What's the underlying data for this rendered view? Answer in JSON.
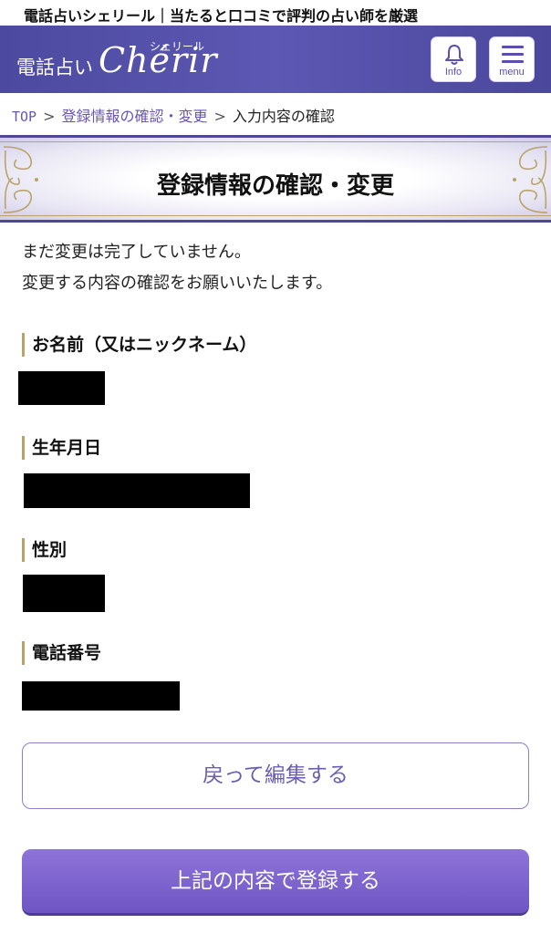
{
  "banner": {
    "text": "電話占いシェリール｜当たると口コミで評判の占い師を厳選"
  },
  "header": {
    "logo_ja": "電話占い",
    "logo_en": "Chérir",
    "logo_kana": "シェリール",
    "info_label": "Info",
    "menu_label": "menu"
  },
  "breadcrumb": {
    "items": [
      {
        "label": "TOP"
      },
      {
        "label": "登録情報の確認・変更"
      },
      {
        "label": "入力内容の確認"
      }
    ],
    "separator": ">"
  },
  "page": {
    "title": "登録情報の確認・変更",
    "intro_line1": "まだ変更は完了していません。",
    "intro_line2": "変更する内容の確認をお願いいたします。"
  },
  "fields": [
    {
      "label": "お名前（又はニックネーム）"
    },
    {
      "label": "生年月日"
    },
    {
      "label": "性別"
    },
    {
      "label": "電話番号"
    }
  ],
  "actions": {
    "back_label": "戻って編集する",
    "submit_label": "上記の内容で登録する"
  },
  "colors": {
    "header_bg": "#5552aa",
    "accent_purple": "#6a55b5",
    "gold": "#b9a36a",
    "submit_bg": "#7b62cc"
  },
  "icons": [
    "bell-icon",
    "hamburger-icon",
    "ornament-icon"
  ]
}
